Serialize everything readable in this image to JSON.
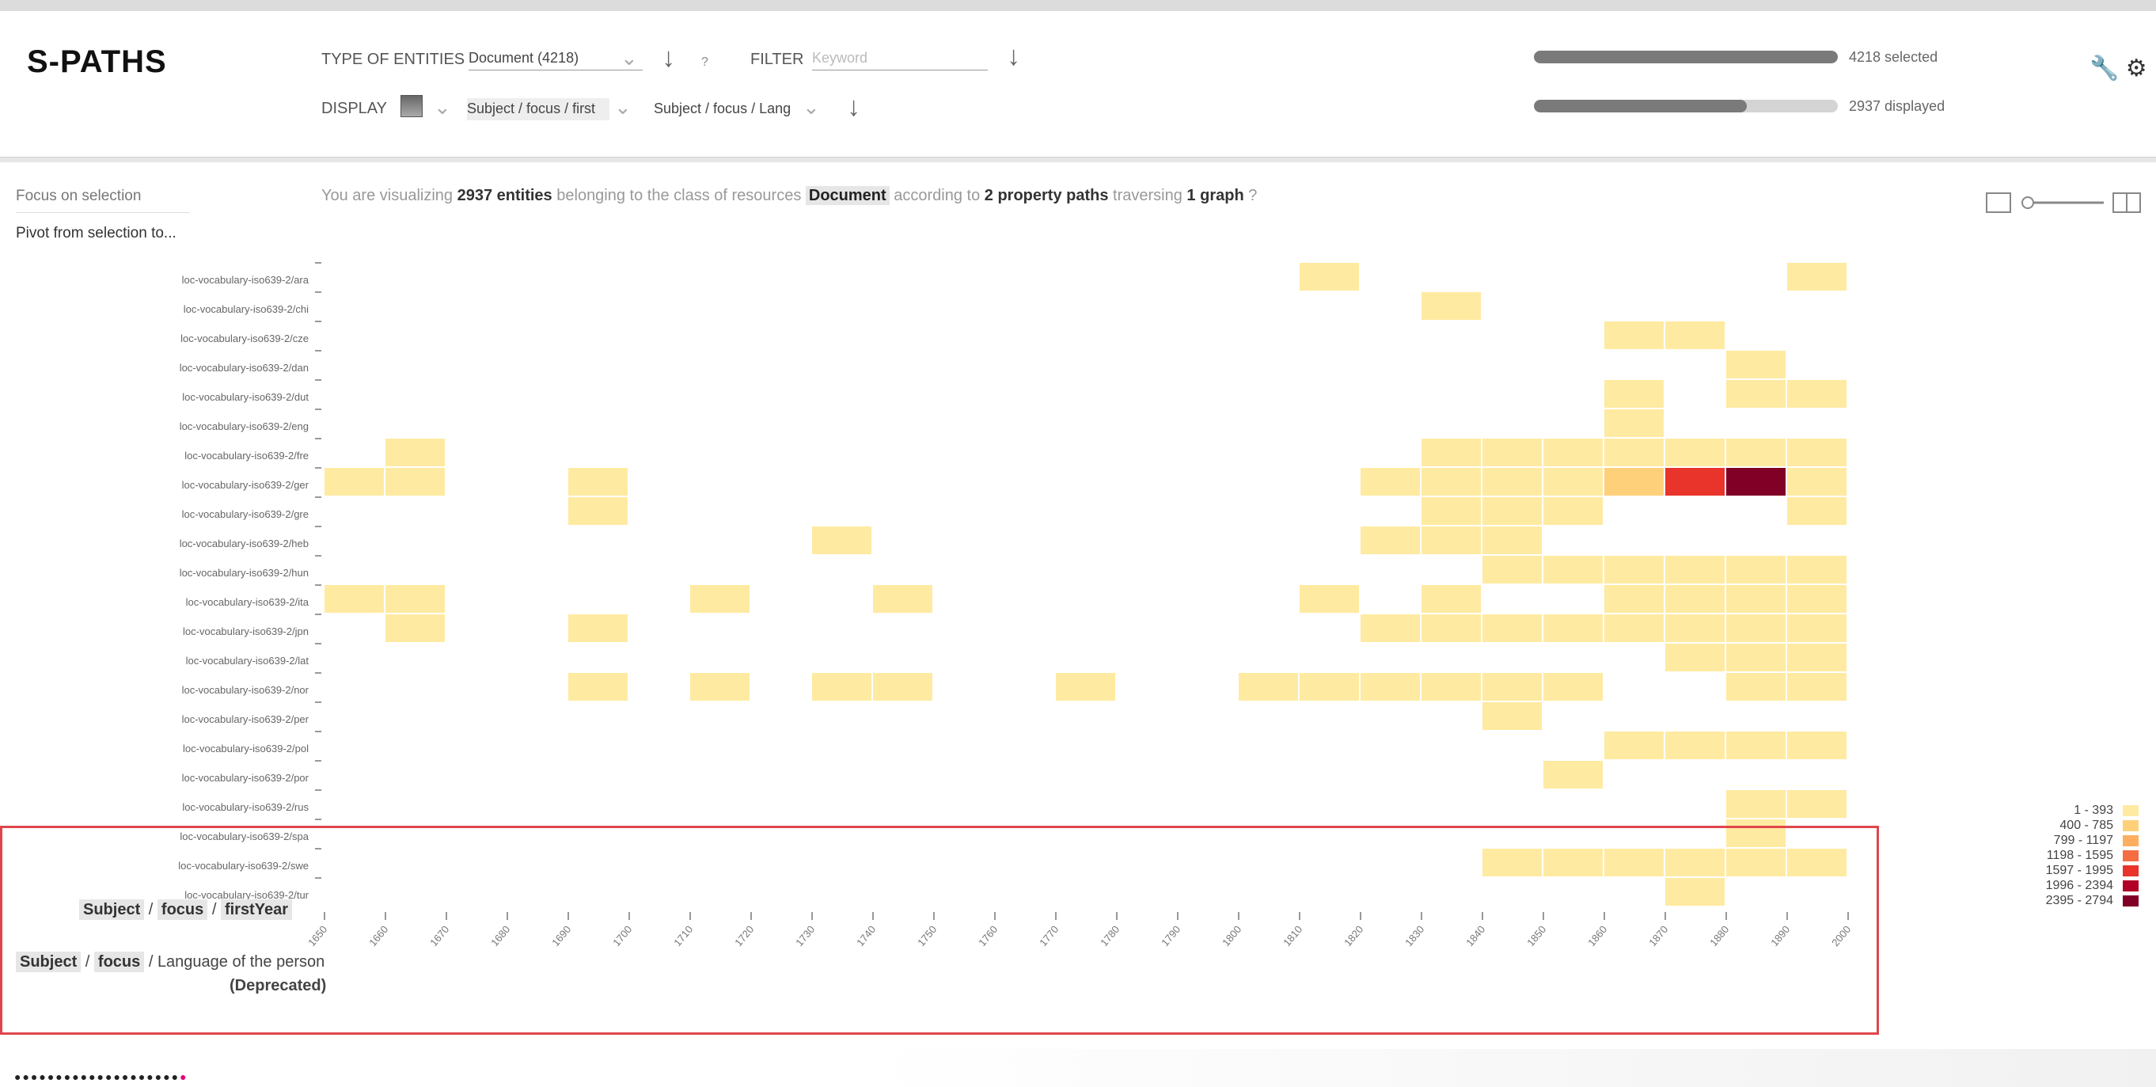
{
  "app": {
    "logo": "S-PATHS"
  },
  "toolbar": {
    "type_label": "TYPE OF ENTITIES",
    "type_value": "Document (4218)",
    "help": "?",
    "filter_label": "FILTER",
    "filter_placeholder": "Keyword",
    "display_label": "DISPLAY",
    "path1_value": "Subject / focus / first",
    "path2_value": "Subject / focus / Lang"
  },
  "progress": {
    "selected": {
      "label": "4218 selected",
      "fraction": 1.0
    },
    "displayed": {
      "label": "2937 displayed",
      "fraction": 0.7
    }
  },
  "sidebar": {
    "focus_label": "Focus on selection",
    "pivot_label": "Pivot from selection to..."
  },
  "summary": {
    "p1": "You are visualizing",
    "count": "2937 entities",
    "p2": "belonging to the class of resources",
    "class": "Document",
    "p3": "according to",
    "paths": "2 property paths",
    "p4": "traversing",
    "graphs": "1 graph",
    "help": "?"
  },
  "axes": {
    "x": {
      "segments": [
        "Subject",
        "focus",
        "firstYear"
      ]
    },
    "y": {
      "segments": [
        "Subject",
        "focus"
      ],
      "tail": "Language of the person",
      "tail2": "(Deprecated)"
    }
  },
  "colors": {
    "accent": "#e0464b",
    "scale": [
      "#ffeaa1",
      "#ffd07a",
      "#fdae61",
      "#f46d43",
      "#e8342b",
      "#b10026",
      "#800026"
    ]
  },
  "chart_data": {
    "type": "heatmap",
    "x_categories": [
      "1650",
      "1660",
      "1670",
      "1680",
      "1690",
      "1700",
      "1710",
      "1720",
      "1730",
      "1740",
      "1750",
      "1760",
      "1770",
      "1780",
      "1790",
      "1800",
      "1810",
      "1820",
      "1830",
      "1840",
      "1850",
      "1860",
      "1870",
      "1880",
      "1890",
      "2000"
    ],
    "y_categories": [
      "loc-vocabulary-iso639-2/ara",
      "loc-vocabulary-iso639-2/chi",
      "loc-vocabulary-iso639-2/cze",
      "loc-vocabulary-iso639-2/dan",
      "loc-vocabulary-iso639-2/dut",
      "loc-vocabulary-iso639-2/eng",
      "loc-vocabulary-iso639-2/fre",
      "loc-vocabulary-iso639-2/ger",
      "loc-vocabulary-iso639-2/gre",
      "loc-vocabulary-iso639-2/heb",
      "loc-vocabulary-iso639-2/hun",
      "loc-vocabulary-iso639-2/ita",
      "loc-vocabulary-iso639-2/jpn",
      "loc-vocabulary-iso639-2/lat",
      "loc-vocabulary-iso639-2/nor",
      "loc-vocabulary-iso639-2/per",
      "loc-vocabulary-iso639-2/pol",
      "loc-vocabulary-iso639-2/por",
      "loc-vocabulary-iso639-2/rus",
      "loc-vocabulary-iso639-2/spa",
      "loc-vocabulary-iso639-2/swe",
      "loc-vocabulary-iso639-2/tur"
    ],
    "cells": [
      [
        0,
        16,
        1
      ],
      [
        0,
        24,
        1
      ],
      [
        1,
        18,
        1
      ],
      [
        2,
        21,
        1
      ],
      [
        2,
        22,
        1
      ],
      [
        3,
        23,
        1
      ],
      [
        4,
        21,
        1
      ],
      [
        4,
        23,
        1
      ],
      [
        4,
        24,
        1
      ],
      [
        5,
        21,
        1
      ],
      [
        6,
        1,
        1
      ],
      [
        6,
        18,
        1
      ],
      [
        6,
        19,
        1
      ],
      [
        6,
        20,
        1
      ],
      [
        6,
        21,
        1
      ],
      [
        6,
        22,
        1
      ],
      [
        6,
        23,
        1
      ],
      [
        6,
        24,
        1
      ],
      [
        7,
        0,
        1
      ],
      [
        7,
        1,
        1
      ],
      [
        7,
        4,
        1
      ],
      [
        7,
        17,
        1
      ],
      [
        7,
        18,
        1
      ],
      [
        7,
        19,
        1
      ],
      [
        7,
        20,
        1
      ],
      [
        7,
        21,
        2
      ],
      [
        7,
        22,
        5
      ],
      [
        7,
        23,
        7
      ],
      [
        7,
        24,
        1
      ],
      [
        8,
        4,
        1
      ],
      [
        8,
        18,
        1
      ],
      [
        8,
        19,
        1
      ],
      [
        8,
        20,
        1
      ],
      [
        8,
        24,
        1
      ],
      [
        9,
        8,
        1
      ],
      [
        9,
        17,
        1
      ],
      [
        9,
        18,
        1
      ],
      [
        9,
        19,
        1
      ],
      [
        10,
        19,
        1
      ],
      [
        10,
        20,
        1
      ],
      [
        10,
        21,
        1
      ],
      [
        10,
        22,
        1
      ],
      [
        10,
        23,
        1
      ],
      [
        10,
        24,
        1
      ],
      [
        11,
        0,
        1
      ],
      [
        11,
        1,
        1
      ],
      [
        11,
        6,
        1
      ],
      [
        11,
        9,
        1
      ],
      [
        11,
        16,
        1
      ],
      [
        11,
        18,
        1
      ],
      [
        11,
        21,
        1
      ],
      [
        11,
        22,
        1
      ],
      [
        11,
        23,
        1
      ],
      [
        11,
        24,
        1
      ],
      [
        12,
        1,
        1
      ],
      [
        12,
        4,
        1
      ],
      [
        12,
        17,
        1
      ],
      [
        12,
        18,
        1
      ],
      [
        12,
        19,
        1
      ],
      [
        12,
        20,
        1
      ],
      [
        12,
        21,
        1
      ],
      [
        12,
        22,
        1
      ],
      [
        12,
        23,
        1
      ],
      [
        12,
        24,
        1
      ],
      [
        13,
        22,
        1
      ],
      [
        13,
        23,
        1
      ],
      [
        13,
        24,
        1
      ],
      [
        14,
        4,
        1
      ],
      [
        14,
        6,
        1
      ],
      [
        14,
        8,
        1
      ],
      [
        14,
        9,
        1
      ],
      [
        14,
        12,
        1
      ],
      [
        14,
        15,
        1
      ],
      [
        14,
        16,
        1
      ],
      [
        14,
        17,
        1
      ],
      [
        14,
        18,
        1
      ],
      [
        14,
        19,
        1
      ],
      [
        14,
        20,
        1
      ],
      [
        14,
        23,
        1
      ],
      [
        14,
        24,
        1
      ],
      [
        15,
        19,
        1
      ],
      [
        16,
        21,
        1
      ],
      [
        16,
        22,
        1
      ],
      [
        16,
        23,
        1
      ],
      [
        16,
        24,
        1
      ],
      [
        17,
        20,
        1
      ],
      [
        18,
        23,
        1
      ],
      [
        18,
        24,
        1
      ],
      [
        19,
        23,
        1
      ],
      [
        20,
        19,
        1
      ],
      [
        20,
        20,
        1
      ],
      [
        20,
        21,
        1
      ],
      [
        20,
        22,
        1
      ],
      [
        20,
        23,
        1
      ],
      [
        20,
        24,
        1
      ],
      [
        21,
        22,
        1
      ]
    ],
    "legend": [
      "1 - 393",
      "400 - 785",
      "799 - 1197",
      "1198 - 1595",
      "1597 - 1995",
      "1996 - 2394",
      "2395 - 2794"
    ]
  }
}
